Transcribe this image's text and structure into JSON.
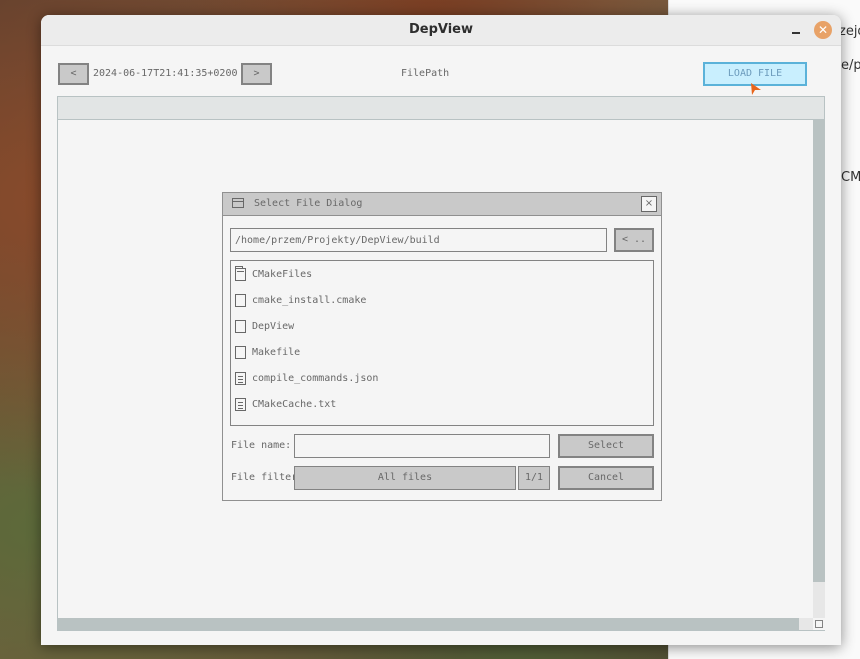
{
  "window": {
    "title": "DepView"
  },
  "background_window": {
    "fragments": [
      "zejd",
      "e/p",
      "CMa"
    ]
  },
  "toolbar": {
    "prev_label": "<",
    "timestamp": "2024-06-17T21:41:35+0200",
    "next_label": ">",
    "file_path_label": "FilePath",
    "load_file_label": "LOAD FILE"
  },
  "dialog": {
    "title": "Select File Dialog",
    "close_label": "×",
    "path": "/home/przem/Projekty/DepView/build",
    "back_label": "< ..",
    "files": [
      {
        "name": "CMakeFiles",
        "icon": "folder-icon"
      },
      {
        "name": "cmake_install.cmake",
        "icon": "file-icon"
      },
      {
        "name": "DepView",
        "icon": "file-icon"
      },
      {
        "name": "Makefile",
        "icon": "file-icon"
      },
      {
        "name": "compile_commands.json",
        "icon": "text-file-icon"
      },
      {
        "name": "CMakeCache.txt",
        "icon": "text-file-icon"
      }
    ],
    "file_name_label": "File name:",
    "file_name_value": "",
    "select_label": "Select",
    "file_filter_label": "File filter:",
    "filter_value": "All files",
    "filter_counter": "1/1",
    "cancel_label": "Cancel"
  },
  "colors": {
    "accent": "#5bb2d9",
    "accent_fill": "#c9effe",
    "close_button": "#e8a267",
    "scrollbar": "#b9c2c2"
  }
}
